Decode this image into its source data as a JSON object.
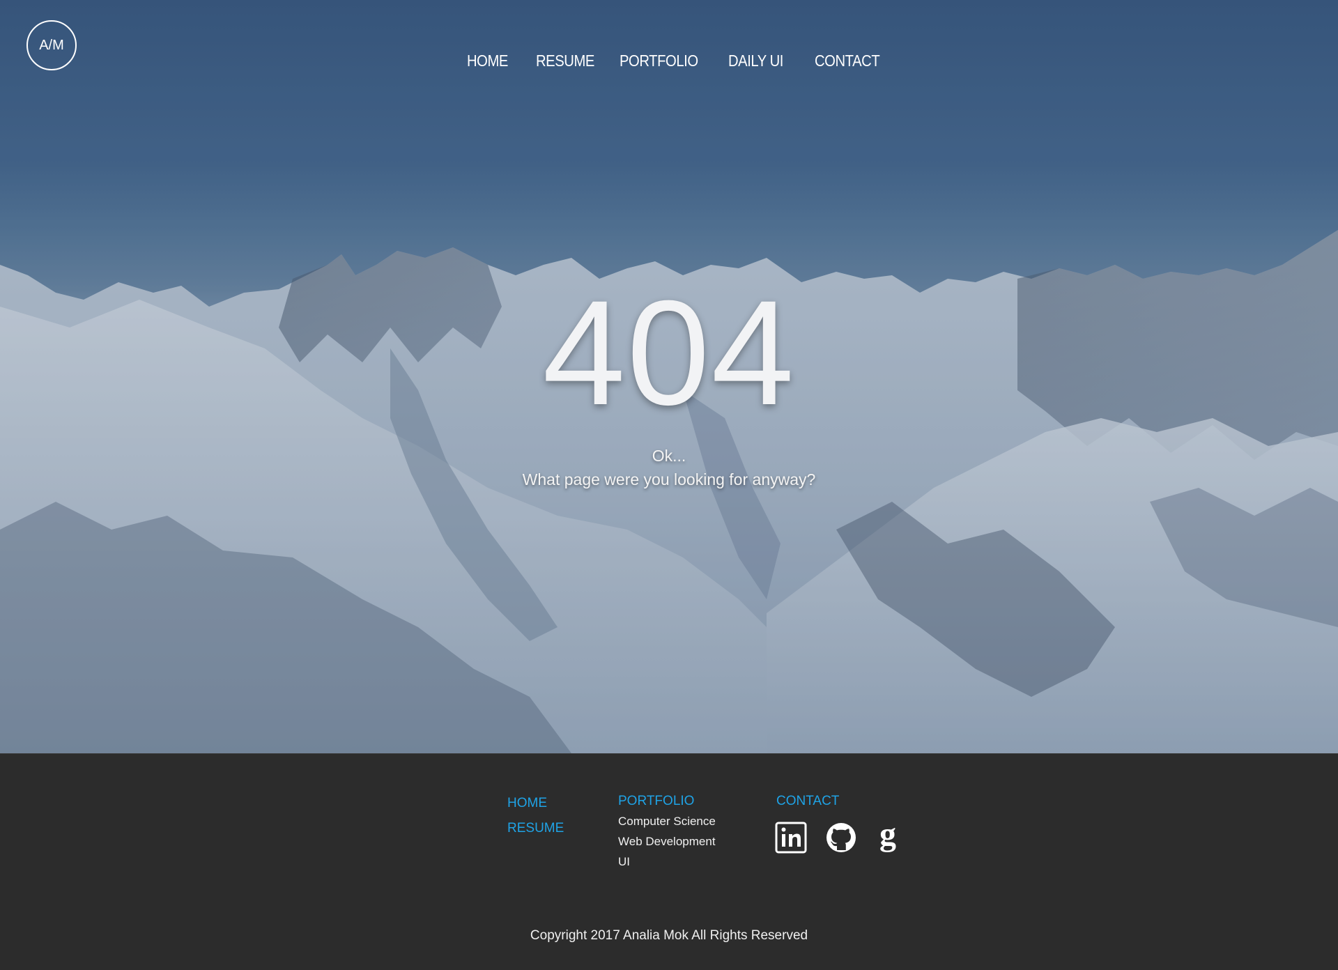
{
  "logo": {
    "text": "A/M"
  },
  "nav": {
    "items": [
      {
        "label": "HOME"
      },
      {
        "label": "RESUME"
      },
      {
        "label": "PORTFOLIO"
      },
      {
        "label": "DAILY UI"
      },
      {
        "label": "CONTACT"
      }
    ]
  },
  "error": {
    "code": "404",
    "line1": "Ok...",
    "line2": "What page were you looking for anyway?"
  },
  "footer": {
    "col1": {
      "home": "HOME",
      "resume": "RESUME"
    },
    "col2": {
      "heading": "PORTFOLIO",
      "items": [
        "Computer Science",
        "Web Development",
        "UI"
      ]
    },
    "col3": {
      "heading": "CONTACT",
      "icons": [
        "linkedin-icon",
        "github-icon",
        "google-icon"
      ]
    },
    "copyright": "Copyright 2017 Analia Mok All Rights Reserved"
  },
  "colors": {
    "accent": "#1fa3e6",
    "footer_bg": "#2c2c2c",
    "sky": "#3c5b82"
  }
}
